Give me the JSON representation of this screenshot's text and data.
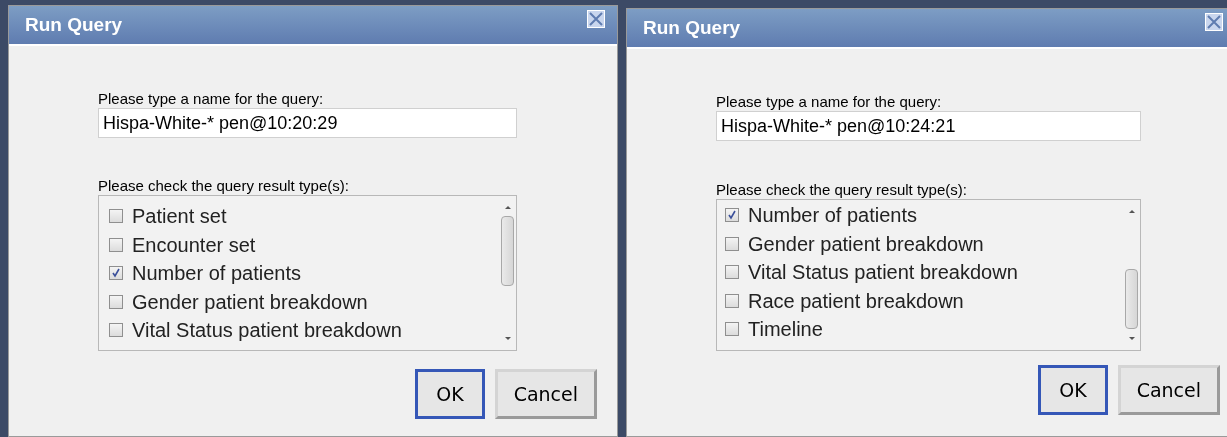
{
  "dialogs": [
    {
      "title": "Run Query",
      "name_label": "Please type a name for the query:",
      "name_value": "Hispa-White-* pen@10:20:29",
      "types_label": "Please check the query result type(s):",
      "result_types": [
        {
          "label": "Patient set",
          "checked": false
        },
        {
          "label": "Encounter set",
          "checked": false
        },
        {
          "label": "Number of patients",
          "checked": true
        },
        {
          "label": "Gender patient breakdown",
          "checked": false
        },
        {
          "label": "Vital Status patient breakdown",
          "checked": false
        }
      ],
      "buttons": [
        {
          "label": "OK",
          "selected": true
        },
        {
          "label": "Cancel",
          "selected": false
        }
      ]
    },
    {
      "title": "Run Query",
      "name_label": "Please type a name for the query:",
      "name_value": "Hispa-White-* pen@10:24:21",
      "types_label": "Please check the query result type(s):",
      "result_types": [
        {
          "label": "Number of patients",
          "checked": true
        },
        {
          "label": "Gender patient breakdown",
          "checked": false
        },
        {
          "label": "Vital Status patient breakdown",
          "checked": false
        },
        {
          "label": "Race patient breakdown",
          "checked": false
        },
        {
          "label": "Timeline",
          "checked": false
        }
      ],
      "buttons": [
        {
          "label": "OK",
          "selected": true
        },
        {
          "label": "Cancel",
          "selected": false
        }
      ]
    }
  ]
}
